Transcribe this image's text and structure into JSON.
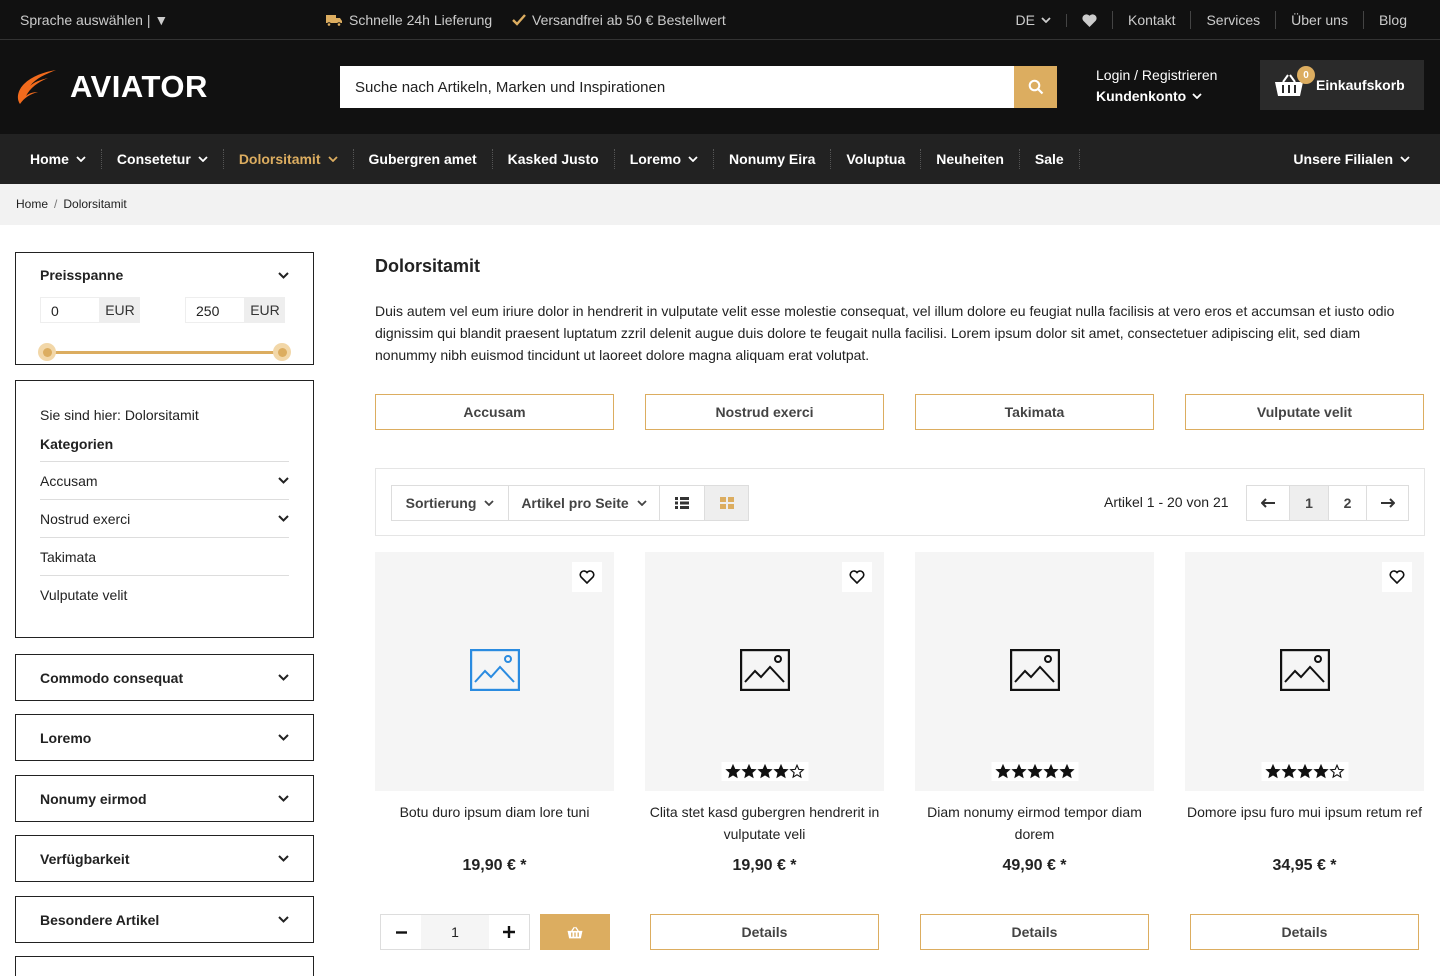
{
  "topbar": {
    "language": "Sprache auswählen | ▼",
    "usp1": "Schnelle 24h Lieferung",
    "usp2": "Versandfrei ab 50 € Bestellwert",
    "lang_code": "DE",
    "links": [
      "Kontakt",
      "Services",
      "Über uns",
      "Blog"
    ]
  },
  "header": {
    "logo": "AVIATOR",
    "search_placeholder": "Suche nach Artikeln, Marken und Inspirationen",
    "login": "Login / Registrieren",
    "account": "Kundenkonto",
    "cart_label": "Einkaufskorb",
    "cart_count": "0"
  },
  "nav": {
    "items": [
      "Home",
      "Consetetur",
      "Dolorsitamit",
      "Gubergren amet",
      "Kasked Justo",
      "Loremo",
      "Nonumy Eira",
      "Voluptua",
      "Neuheiten",
      "Sale"
    ],
    "right": "Unsere Filialen"
  },
  "breadcrumb": {
    "home": "Home",
    "current": "Dolorsitamit"
  },
  "price_filter": {
    "title": "Preisspanne",
    "min": "0",
    "max": "250",
    "currency": "EUR"
  },
  "categories": {
    "you_are_here": "Sie sind hier: Dolorsitamit",
    "title": "Kategorien",
    "items": [
      "Accusam",
      "Nostrud exerci",
      "Takimata",
      "Vulputate velit"
    ]
  },
  "filters": [
    "Commodo consequat",
    "Loremo",
    "Nonumy eirmod",
    "Verfügbarkeit",
    "Besondere Artikel"
  ],
  "page": {
    "title": "Dolorsitamit",
    "description": "Duis autem vel eum iriure dolor in hendrerit in vulputate velit esse molestie consequat, vel illum dolore eu feugiat nulla facilisis at vero eros et accumsan et iusto odio dignissim qui blandit praesent luptatum zzril delenit augue duis dolore te feugait nulla facilisi. Lorem ipsum dolor sit amet, consectetuer adipiscing elit, sed diam nonummy nibh euismod tincidunt ut laoreet dolore magna aliquam erat volutpat.",
    "subcategories": [
      "Accusam",
      "Nostrud exerci",
      "Takimata",
      "Vulputate velit"
    ]
  },
  "toolbar": {
    "sort": "Sortierung",
    "per_page": "Artikel pro Seite",
    "count": "Artikel 1 - 20 von 21",
    "pages": [
      "1",
      "2"
    ]
  },
  "products": [
    {
      "name": "Botu duro ipsum diam lore tuni",
      "price": "19,90 € *",
      "rating": 0
    },
    {
      "name": "Clita stet kasd gubergren hendrerit in vulputate veli",
      "price": "19,90 € *",
      "rating": 4
    },
    {
      "name": "Diam nonumy eirmod tempor diam dorem",
      "price": "49,90 € *",
      "rating": 5
    },
    {
      "name": "Domore ipsu furo mui ipsum retum ref",
      "price": "34,95 € *",
      "rating": 4
    }
  ],
  "actions": {
    "details": "Details",
    "qty": "1"
  },
  "colors": {
    "accent": "#dcad60",
    "dark": "#111111",
    "logo": "#f26b1d"
  }
}
